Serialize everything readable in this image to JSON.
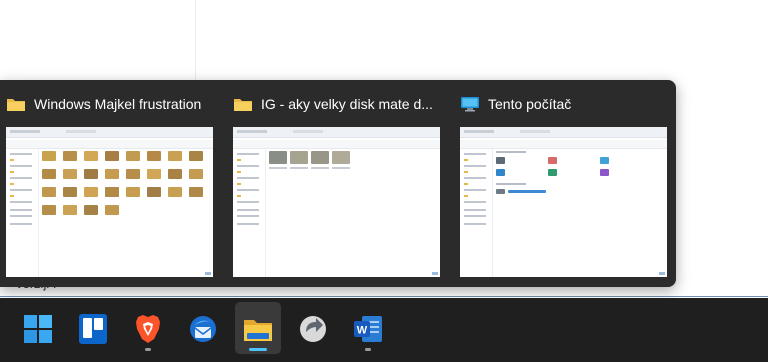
{
  "background": {
    "partial_text": "verziji !"
  },
  "thumbnails": [
    {
      "title": "Windows Majkel frustration",
      "icon": "folder-icon"
    },
    {
      "title": "IG - aky velky disk mate d...",
      "icon": "folder-icon"
    },
    {
      "title": "Tento počítač",
      "icon": "this-pc-icon"
    }
  ],
  "taskbar": {
    "items": [
      {
        "name": "start",
        "icon": "windows-start-icon"
      },
      {
        "name": "widgets",
        "icon": "trello-icon"
      },
      {
        "name": "brave",
        "icon": "brave-browser-icon"
      },
      {
        "name": "thunderbird",
        "icon": "thunderbird-mail-icon"
      },
      {
        "name": "file-explorer",
        "icon": "file-explorer-icon"
      },
      {
        "name": "app",
        "icon": "circular-arrow-app-icon"
      },
      {
        "name": "word",
        "icon": "word-icon"
      }
    ]
  },
  "colors": {
    "popup_bg": "#2b2b2b",
    "taskbar_bg": "#1f1f1f",
    "accent": "#4cc2ff"
  }
}
